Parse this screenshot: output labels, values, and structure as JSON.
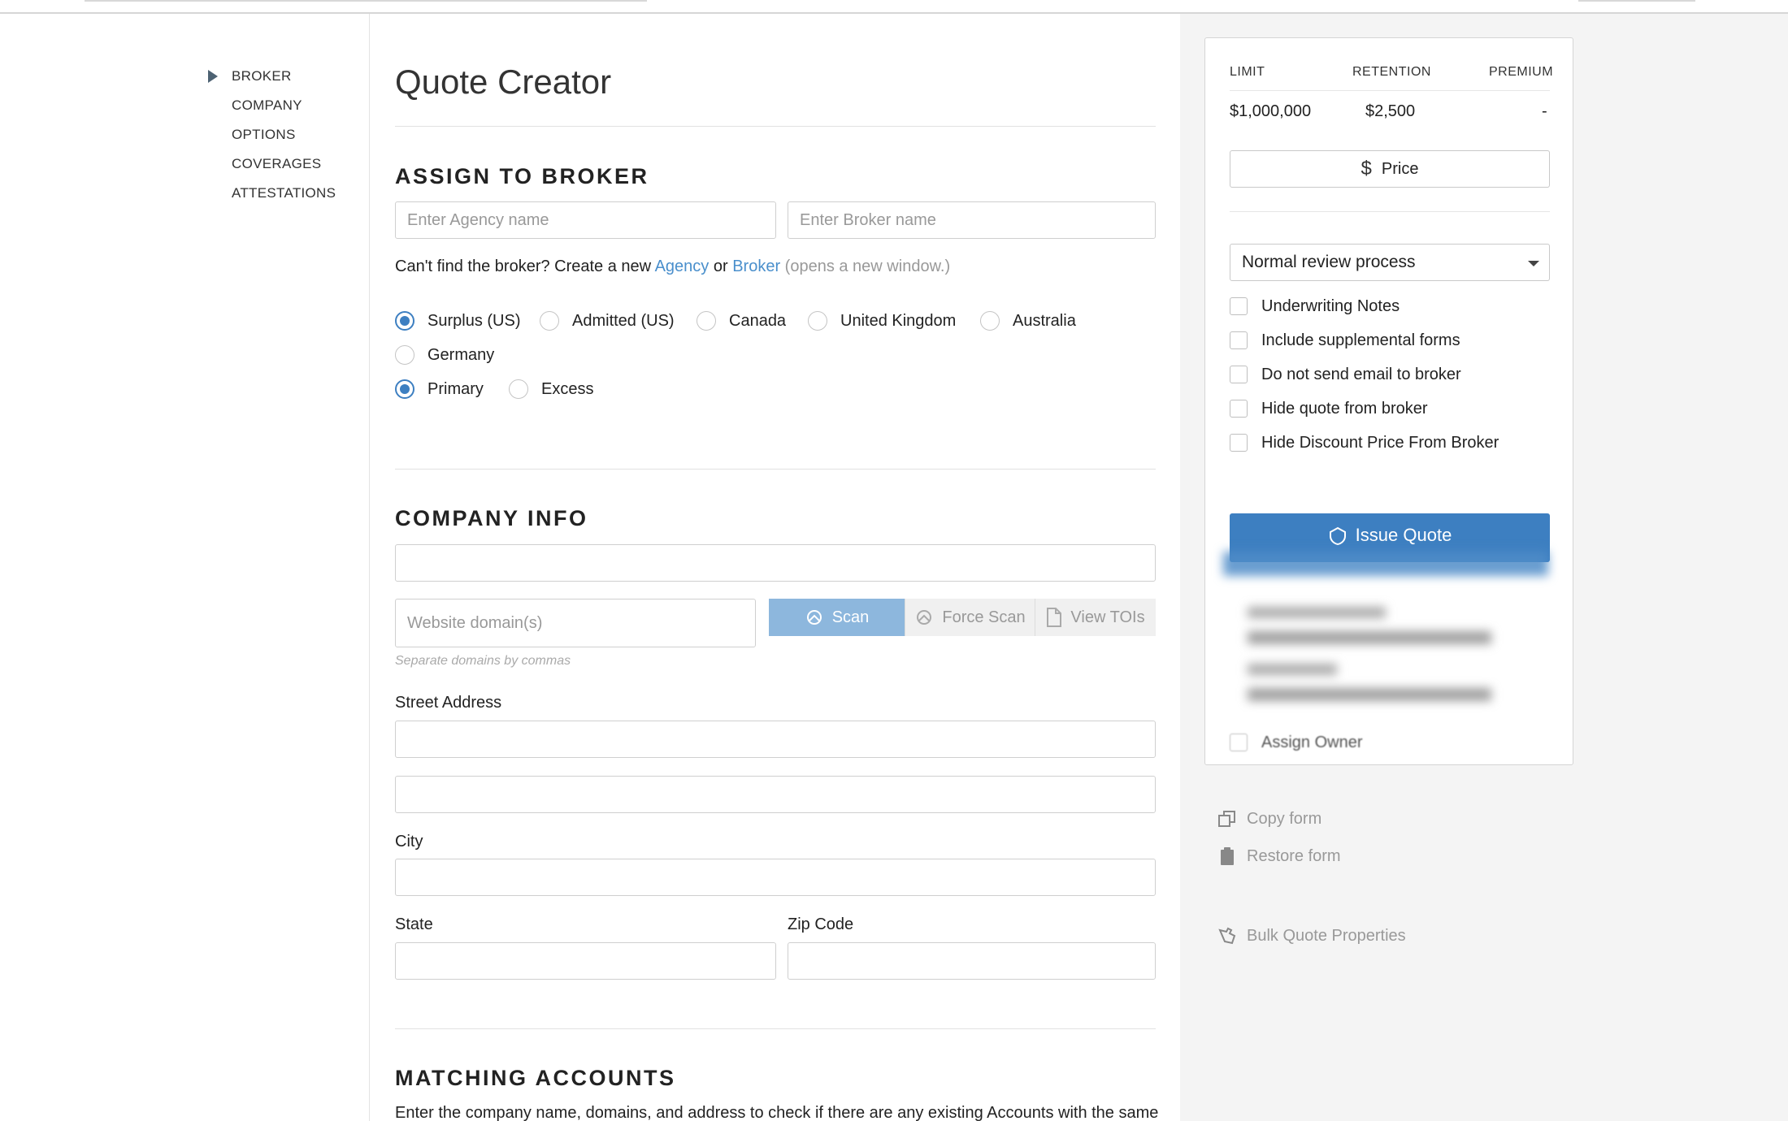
{
  "nav": {
    "items": [
      {
        "label": "BROKER",
        "active": true
      },
      {
        "label": "COMPANY"
      },
      {
        "label": "OPTIONS"
      },
      {
        "label": "COVERAGES"
      },
      {
        "label": "ATTESTATIONS"
      }
    ]
  },
  "page": {
    "title": "Quote Creator"
  },
  "broker": {
    "section_title": "ASSIGN TO BROKER",
    "agency_placeholder": "Enter Agency name",
    "broker_placeholder": "Enter Broker name",
    "help_prefix": "Can't find the broker? Create a new",
    "agency_link": "Agency",
    "or": "or",
    "broker_link": "Broker",
    "help_suffix": "(opens a new window.)",
    "regions": [
      {
        "label": "Surplus (US)",
        "checked": true
      },
      {
        "label": "Admitted (US)",
        "checked": false
      },
      {
        "label": "Canada",
        "checked": false
      },
      {
        "label": "United Kingdom",
        "checked": false
      },
      {
        "label": "Australia",
        "checked": false
      },
      {
        "label": "Germany",
        "checked": false
      }
    ],
    "layers": [
      {
        "label": "Primary",
        "checked": true
      },
      {
        "label": "Excess",
        "checked": false
      }
    ]
  },
  "company": {
    "section_title": "COMPANY INFO",
    "name_value": "",
    "website_placeholder": "Website domain(s)",
    "scan_label": "Scan",
    "force_scan_label": "Force Scan",
    "view_tois_label": "View TOIs",
    "domains_hint": "Separate domains by commas",
    "street_label": "Street Address",
    "city_label": "City",
    "state_label": "State",
    "zip_label": "Zip Code"
  },
  "matching": {
    "section_title": "MATCHING ACCOUNTS",
    "description": "Enter the company name, domains, and address to check if there are any existing Accounts with the same"
  },
  "summary": {
    "limit_header": "LIMIT",
    "retention_header": "RETENTION",
    "premium_header": "PREMIUM",
    "limit_value": "$1,000,000",
    "retention_value": "$2,500",
    "premium_value": "-",
    "price_label": "Price",
    "review_process": "Normal review process",
    "options": [
      {
        "label": "Underwriting Notes",
        "checked": false
      },
      {
        "label": "Include supplemental forms",
        "checked": false
      },
      {
        "label": "Do not send email to broker",
        "checked": false
      },
      {
        "label": "Hide quote from broker",
        "checked": false
      },
      {
        "label": "Hide Discount Price From Broker",
        "checked": false
      }
    ],
    "issue_label": "Issue Quote",
    "assign_owner_label": "Assign Owner"
  },
  "side_actions": {
    "copy_form": "Copy form",
    "restore_form": "Restore form",
    "bulk_quote": "Bulk Quote Properties"
  },
  "colors": {
    "accent": "#3d7fc1",
    "link": "#4a8fcc",
    "scan_disabled": "#8db7dd",
    "panel_bg": "#f4f4f4"
  }
}
